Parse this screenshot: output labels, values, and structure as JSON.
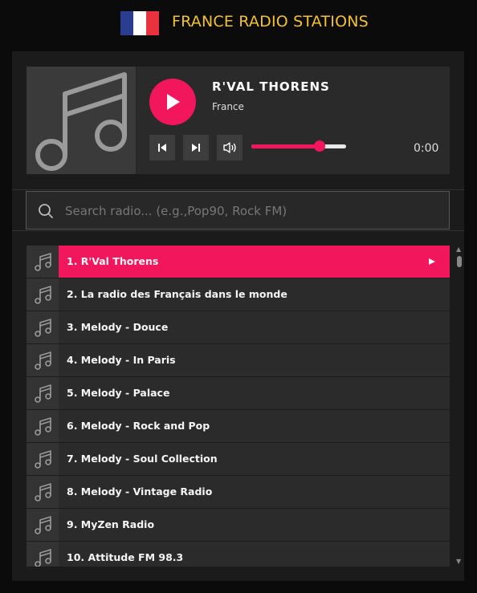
{
  "header": {
    "title": "FRANCE RADIO STATIONS",
    "flag_colors": [
      "#2a3d8f",
      "#ffffff",
      "#e8333f"
    ]
  },
  "player": {
    "artwork_icon": "music-note-icon",
    "station_name": "R'VAL THORENS",
    "country": "France",
    "time": "0:00",
    "volume": 0.72
  },
  "search": {
    "placeholder": "Search radio... (e.g.,Pop90, Rock FM)",
    "value": ""
  },
  "stations": [
    {
      "label": "1.  R'Val Thorens",
      "active": true
    },
    {
      "label": "2.  La radio des Français dans le monde",
      "active": false
    },
    {
      "label": "3.  Melody - Douce",
      "active": false
    },
    {
      "label": "4.  Melody - In Paris",
      "active": false
    },
    {
      "label": "5.  Melody - Palace",
      "active": false
    },
    {
      "label": "6.  Melody - Rock and Pop",
      "active": false
    },
    {
      "label": "7.  Melody - Soul Collection",
      "active": false
    },
    {
      "label": "8.  Melody - Vintage Radio",
      "active": false
    },
    {
      "label": "9.  MyZen Radio",
      "active": false
    },
    {
      "label": "10.  Attitude FM 98.3",
      "active": false
    }
  ],
  "colors": {
    "accent": "#f2165c",
    "title": "#f2c230"
  }
}
